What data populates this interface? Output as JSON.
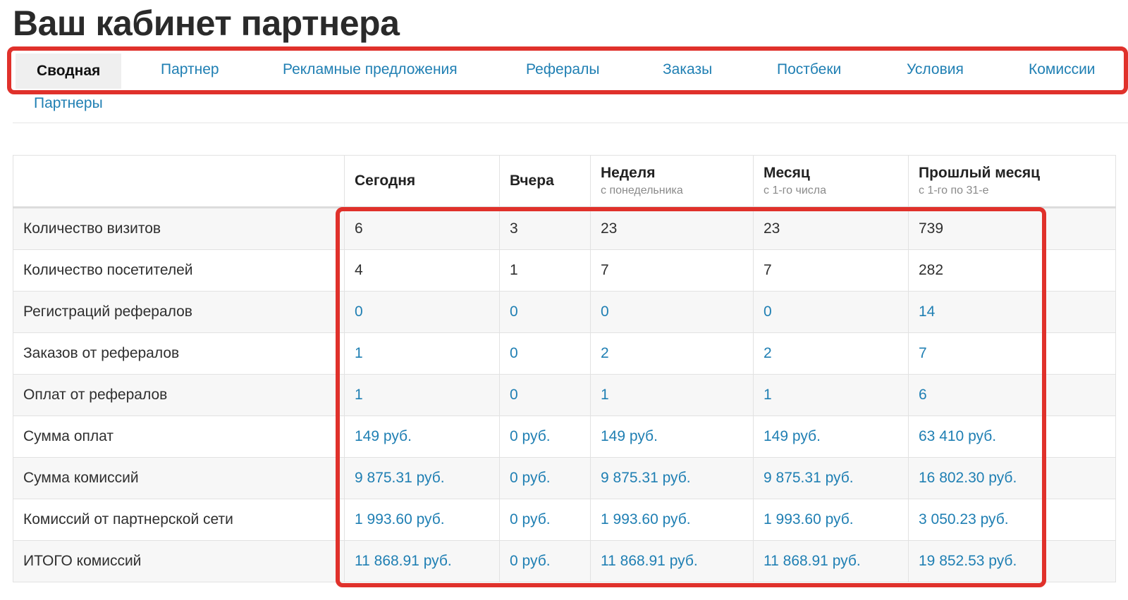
{
  "page": {
    "title": "Ваш кабинет партнера"
  },
  "tabs": [
    {
      "label": "Сводная",
      "active": true
    },
    {
      "label": "Партнер"
    },
    {
      "label": "Рекламные предложения"
    },
    {
      "label": "Рефералы"
    },
    {
      "label": "Заказы"
    },
    {
      "label": "Постбеки"
    },
    {
      "label": "Условия"
    },
    {
      "label": "Комиссии"
    },
    {
      "label": "Партнеры"
    }
  ],
  "table": {
    "columns": [
      {
        "title": "",
        "sub": ""
      },
      {
        "title": "Сегодня",
        "sub": ""
      },
      {
        "title": "Вчера",
        "sub": ""
      },
      {
        "title": "Неделя",
        "sub": "с понедельника"
      },
      {
        "title": "Месяц",
        "sub": "с 1-го числа"
      },
      {
        "title": "Прошлый месяц",
        "sub": "с 1-го по 31-е"
      }
    ],
    "rows": [
      {
        "label": "Количество визитов",
        "link": false,
        "values": [
          "6",
          "3",
          "23",
          "23",
          "739"
        ]
      },
      {
        "label": "Количество посетителей",
        "link": false,
        "values": [
          "4",
          "1",
          "7",
          "7",
          "282"
        ]
      },
      {
        "label": "Регистраций рефералов",
        "link": true,
        "values": [
          "0",
          "0",
          "0",
          "0",
          "14"
        ]
      },
      {
        "label": "Заказов от рефералов",
        "link": true,
        "values": [
          "1",
          "0",
          "2",
          "2",
          "7"
        ]
      },
      {
        "label": "Оплат от рефералов",
        "link": true,
        "values": [
          "1",
          "0",
          "1",
          "1",
          "6"
        ]
      },
      {
        "label": "Сумма оплат",
        "link": true,
        "values": [
          "149 руб.",
          "0 руб.",
          "149 руб.",
          "149 руб.",
          "63 410 руб."
        ]
      },
      {
        "label": "Сумма комиссий",
        "link": true,
        "values": [
          "9 875.31 руб.",
          "0 руб.",
          "9 875.31 руб.",
          "9 875.31 руб.",
          "16 802.30 руб."
        ]
      },
      {
        "label": "Комиссий от партнерской сети",
        "link": true,
        "values": [
          "1 993.60 руб.",
          "0 руб.",
          "1 993.60 руб.",
          "1 993.60 руб.",
          "3 050.23 руб."
        ]
      },
      {
        "label": "ИТОГО комиссий",
        "link": true,
        "values": [
          "11 868.91 руб.",
          "0 руб.",
          "11 868.91 руб.",
          "11 868.91 руб.",
          "19 852.53 руб."
        ]
      }
    ]
  },
  "colors": {
    "link": "#1f7fb3",
    "highlight": "#e0312b",
    "active_tab_bg": "#efefef"
  }
}
